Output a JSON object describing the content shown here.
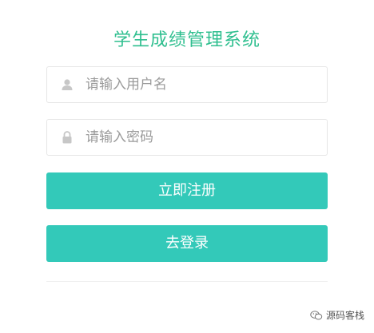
{
  "title": "学生成绩管理系统",
  "form": {
    "username_placeholder": "请输入用户名",
    "password_placeholder": "请输入密码",
    "username_icon": "user-icon",
    "password_icon": "lock-icon"
  },
  "buttons": {
    "register": "立即注册",
    "login": "去登录"
  },
  "watermark": {
    "text": "源码客栈",
    "icon": "wechat-icon"
  },
  "colors": {
    "title": "#2fbf8f",
    "button": "#33c9b9",
    "border": "#e6e6e6"
  }
}
